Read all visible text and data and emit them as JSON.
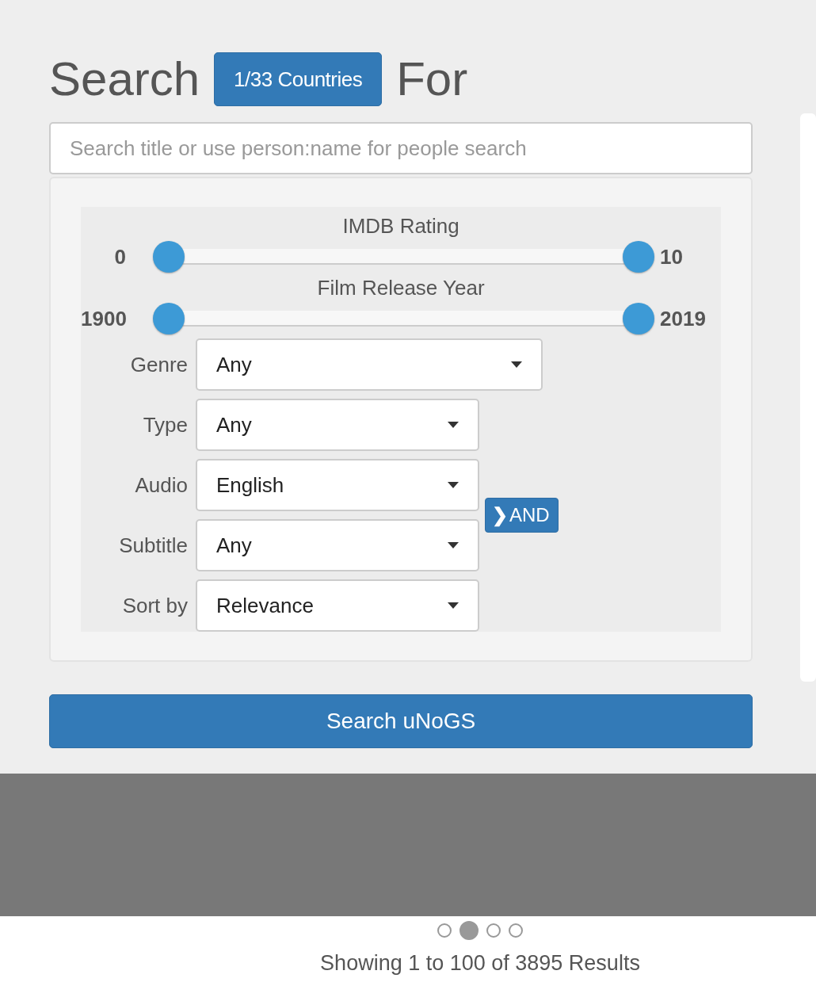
{
  "heading": {
    "before": "Search",
    "countries_button": "1/33 Countries",
    "after": "For"
  },
  "search": {
    "placeholder": "Search title or use person:name for people search"
  },
  "sliders": [
    {
      "label": "IMDB Rating",
      "min_label": "0",
      "max_label": "10",
      "thumbs": [
        {
          "level": 0
        },
        {
          "level": 1
        }
      ]
    },
    {
      "label": "Film Release Year",
      "min_label": "1900",
      "max_label": "2019",
      "thumbs": [
        {
          "level": 0
        },
        {
          "level": 1
        }
      ]
    }
  ],
  "filters": [
    {
      "label": "Genre",
      "value": "Any",
      "wide": true
    },
    {
      "label": "Type",
      "value": "Any",
      "wide": false
    },
    {
      "label": "Audio",
      "value": "English",
      "wide": false
    },
    {
      "label": "Subtitle",
      "value": "Any",
      "wide": false
    },
    {
      "label": "Sort by",
      "value": "Relevance",
      "wide": false
    }
  ],
  "and_button": {
    "icon": "❯",
    "label": "AND"
  },
  "search_button": "Search uNoGS",
  "carousel_dots": [
    {
      "selected": false
    },
    {
      "selected": true
    },
    {
      "selected": false
    },
    {
      "selected": false
    }
  ],
  "results_text": "Showing 1 to 100 of 3895 Results"
}
